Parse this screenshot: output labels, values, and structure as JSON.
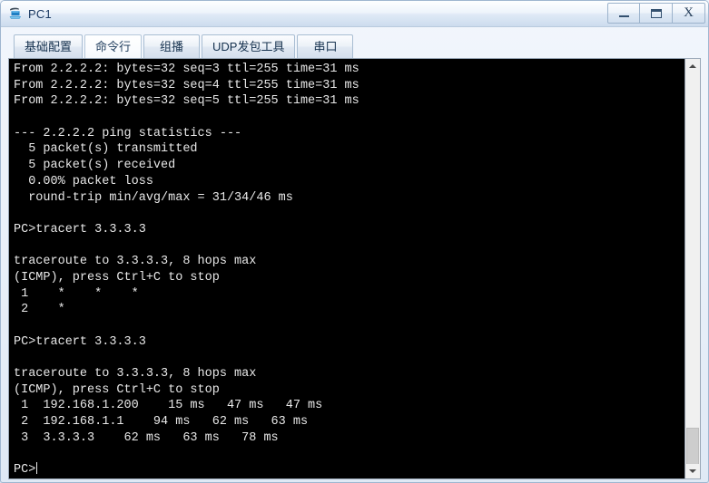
{
  "window": {
    "title": "PC1",
    "icon": "pc-device-icon",
    "controls": {
      "minimize_label": "–",
      "maximize_label": "▭",
      "close_label": "X"
    }
  },
  "tabs": [
    {
      "label": "基础配置",
      "name": "tab-basic-config",
      "active": false
    },
    {
      "label": "命令行",
      "name": "tab-command-line",
      "active": true
    },
    {
      "label": "组播",
      "name": "tab-multicast",
      "active": false
    },
    {
      "label": "UDP发包工具",
      "name": "tab-udp-tool",
      "active": false
    },
    {
      "label": "串口",
      "name": "tab-serial-port",
      "active": false
    }
  ],
  "terminal": {
    "prompt": "PC>",
    "lines": [
      "From 2.2.2.2: bytes=32 seq=3 ttl=255 time=31 ms",
      "From 2.2.2.2: bytes=32 seq=4 ttl=255 time=31 ms",
      "From 2.2.2.2: bytes=32 seq=5 ttl=255 time=31 ms",
      "",
      "--- 2.2.2.2 ping statistics ---",
      "  5 packet(s) transmitted",
      "  5 packet(s) received",
      "  0.00% packet loss",
      "  round-trip min/avg/max = 31/34/46 ms",
      "",
      "PC>tracert 3.3.3.3",
      "",
      "traceroute to 3.3.3.3, 8 hops max",
      "(ICMP), press Ctrl+C to stop",
      " 1    *    *    *",
      " 2    *",
      "",
      "PC>tracert 3.3.3.3",
      "",
      "traceroute to 3.3.3.3, 8 hops max",
      "(ICMP), press Ctrl+C to stop",
      " 1  192.168.1.200    15 ms   47 ms   47 ms",
      " 2  192.168.1.1    94 ms   62 ms   63 ms",
      " 3  3.3.3.3    62 ms   63 ms   78 ms",
      "",
      "PC>"
    ],
    "colors": {
      "background": "#000000",
      "foreground": "#e8e8e8"
    }
  },
  "scrollbar": {
    "up_arrow": "scroll-up-arrow",
    "down_arrow": "scroll-down-arrow",
    "thumb_top_pct": 88,
    "thumb_height_pct": 9
  }
}
